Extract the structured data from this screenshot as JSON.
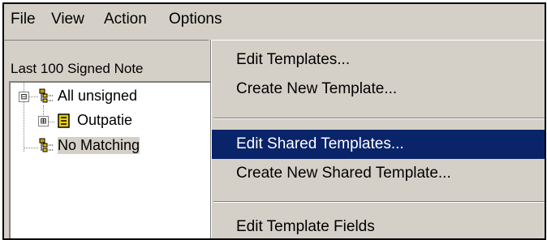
{
  "menubar": {
    "items": [
      {
        "label": "File"
      },
      {
        "label": "View"
      },
      {
        "label": "Action"
      },
      {
        "label": "Options"
      }
    ]
  },
  "panel": {
    "label": "Last 100 Signed Note"
  },
  "tree": {
    "nodes": [
      {
        "label": "All unsigned",
        "expander": "⊟",
        "icon": "tree-list-icon"
      },
      {
        "label": "Outpatie",
        "expander": "⊞",
        "icon": "note-folder-icon"
      },
      {
        "label": "No Matching",
        "icon": "tree-list-icon"
      }
    ]
  },
  "options_menu": {
    "items": [
      {
        "label": "Edit Templates..."
      },
      {
        "label": "Create New Template..."
      },
      {
        "label": "Edit Shared Templates..."
      },
      {
        "label": "Create New Shared Template..."
      },
      {
        "label": "Edit Template Fields"
      }
    ],
    "highlight_color": "#0a246a"
  }
}
